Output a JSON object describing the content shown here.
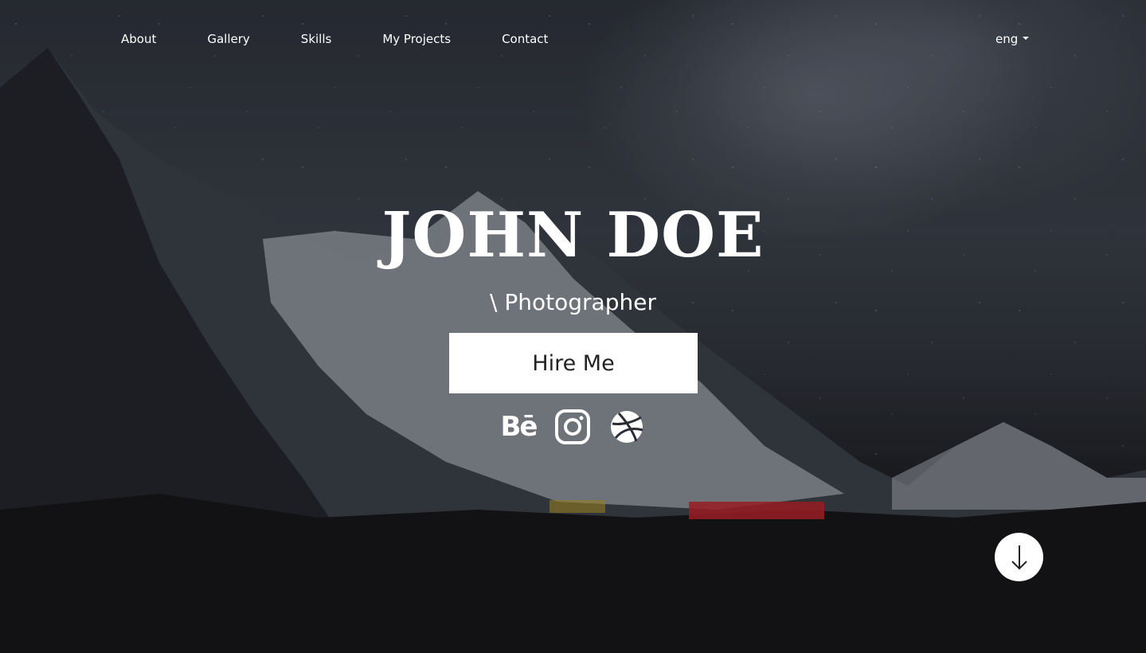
{
  "nav": {
    "items": [
      {
        "label": "About"
      },
      {
        "label": "Gallery"
      },
      {
        "label": "Skills"
      },
      {
        "label": "My Projects"
      },
      {
        "label": "Contact"
      }
    ]
  },
  "language": {
    "selected": "eng"
  },
  "hero": {
    "name": "JOHN DOE",
    "role": "\\ Photographer",
    "cta_label": "Hire Me"
  },
  "socials": {
    "behance_text": "Bē",
    "icons": [
      "behance-icon",
      "instagram-icon",
      "dribbble-icon"
    ]
  },
  "scroll": {
    "icon": "arrow-down-icon"
  },
  "colors": {
    "text": "#ffffff",
    "button_bg": "#ffffff",
    "button_text": "#222222"
  }
}
